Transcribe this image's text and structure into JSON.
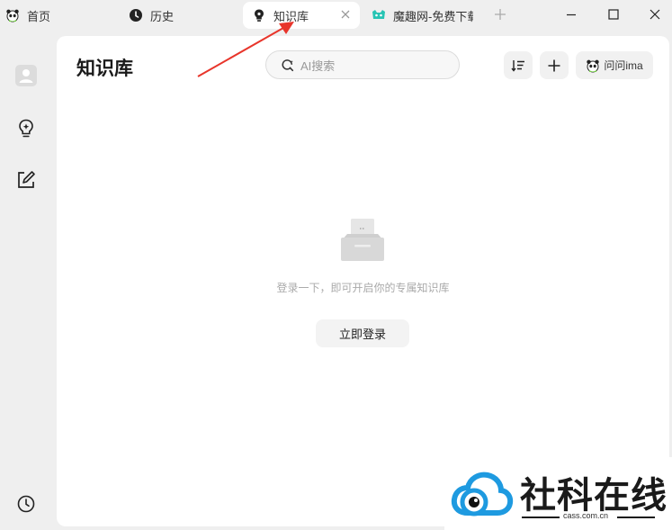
{
  "tabs": [
    {
      "label": "首页",
      "icon": "panda-icon"
    },
    {
      "label": "历史",
      "icon": "clock-icon"
    },
    {
      "label": "知识库",
      "icon": "bulb-icon",
      "active": true
    },
    {
      "label": "魔趣网-免费下载",
      "icon": "game-icon"
    }
  ],
  "window_controls": [
    "minimize-icon",
    "maximize-icon",
    "close-icon"
  ],
  "sidebar": {
    "items": [
      {
        "name": "avatar",
        "icon": "user-icon"
      },
      {
        "name": "knowledge",
        "icon": "bulb-plus-icon"
      },
      {
        "name": "notes",
        "icon": "edit-icon"
      },
      {
        "name": "history",
        "icon": "clock-icon"
      }
    ]
  },
  "main": {
    "title": "知识库",
    "search_placeholder": "AI搜索",
    "ask_label": "问问ima",
    "empty_text": "登录一下，即可开启你的专属知识库",
    "login_label": "立即登录"
  },
  "watermark": {
    "title": "社科在线",
    "domain": "cass.com.cn"
  },
  "colors": {
    "accent_red": "#e8352b",
    "watermark_blue": "#1e9ae0",
    "panda_green": "#7bd14d"
  }
}
